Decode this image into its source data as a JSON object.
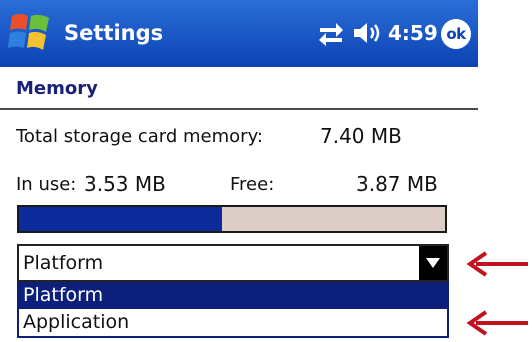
{
  "titlebar": {
    "app_title": "Settings",
    "clock": "4:59",
    "ok_label": "ok",
    "icons": [
      "windows-start-icon",
      "connectivity-icon",
      "volume-icon",
      "ok-button"
    ]
  },
  "page": {
    "header": "Memory"
  },
  "storage": {
    "total_label": "Total storage card memory:",
    "total_value": "7.40 MB",
    "in_use_label": "In use:",
    "in_use_value": "3.53 MB",
    "free_label": "Free:",
    "free_value": "3.87 MB",
    "usage_fraction": 0.477
  },
  "dropdown": {
    "selected": "Platform",
    "options": [
      "Platform",
      "Application"
    ],
    "highlighted_index": 0
  },
  "colors": {
    "titlebar": "#0c43b3",
    "header_text": "#1a1f7a",
    "progress_fill": "#0c2a9a",
    "progress_bg": "#dccec6",
    "highlight": "#0c1f7a",
    "annotation_arrow": "#c1121f"
  }
}
